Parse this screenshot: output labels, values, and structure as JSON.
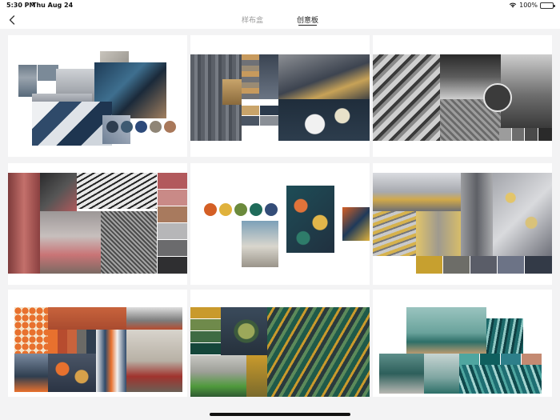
{
  "status_bar": {
    "time": "5:30 PM",
    "date": "Thu Aug 24",
    "battery": "100%"
  },
  "nav": {
    "back_icon": "chevron-left-icon",
    "tabs": [
      {
        "label": "样布盒",
        "active": false
      },
      {
        "label": "创意板",
        "active": true
      }
    ]
  },
  "boards": [
    {
      "swatches": [
        "#2e3d4f",
        "#3e5a72",
        "#2d4a7a",
        "#8f8576",
        "#a9785a"
      ]
    },
    {
      "swatches": [
        "#c9a46a",
        "#4b5563",
        "#2b3a4c",
        "#8a8f96"
      ]
    },
    {
      "swatches": [
        "#3b3b3b",
        "#9c9c9c",
        "#6e6e6e",
        "#4a4a4a",
        "#2a2a2a"
      ]
    },
    {
      "swatches": [
        "#b2595c",
        "#c98a87",
        "#a87a5e",
        "#b6b6b8",
        "#6b6b6d",
        "#2f2f31"
      ]
    },
    {
      "swatches": [
        "#d45f25",
        "#e0b23c",
        "#6b8a3c",
        "#1f6b5a",
        "#344d78"
      ]
    },
    {
      "swatches": [
        "#c7a02f",
        "#6d6d68",
        "#5a5d68",
        "#6c7386",
        "#333a47"
      ]
    },
    {
      "swatches": [
        "#e8712e",
        "#b74c2f",
        "#c8633c",
        "#6b6a66",
        "#2f3e4f"
      ]
    },
    {
      "swatches": [
        "#c99a2c",
        "#6f8a4b",
        "#3e6b43",
        "#14463a",
        "#4f9a3c"
      ]
    },
    {
      "swatches": [
        "#4fa6a0",
        "#0f5f5e",
        "#2d7f8a",
        "#c48a72"
      ]
    }
  ]
}
